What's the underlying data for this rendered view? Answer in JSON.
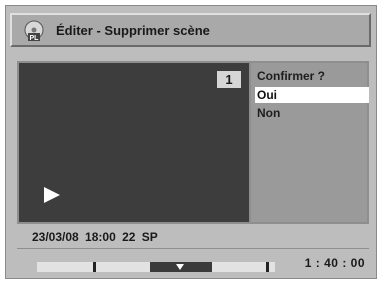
{
  "header": {
    "icon": "pl-disc-icon",
    "icon_label": "PL",
    "title": "Éditer - Supprimer scène"
  },
  "preview": {
    "scene_number": "1",
    "state_icon": "play-icon"
  },
  "confirm_dialog": {
    "prompt": "Confirmer ?",
    "options": [
      {
        "label": "Oui",
        "selected": true
      },
      {
        "label": "Non",
        "selected": false
      }
    ]
  },
  "info": {
    "text": "23/03/08 18:00 22 SP"
  },
  "timeline": {
    "time": "1 : 40 : 00"
  },
  "colors": {
    "background": "#bdbdbd",
    "video": "#3d3d3d",
    "selection": "#ffffff"
  }
}
